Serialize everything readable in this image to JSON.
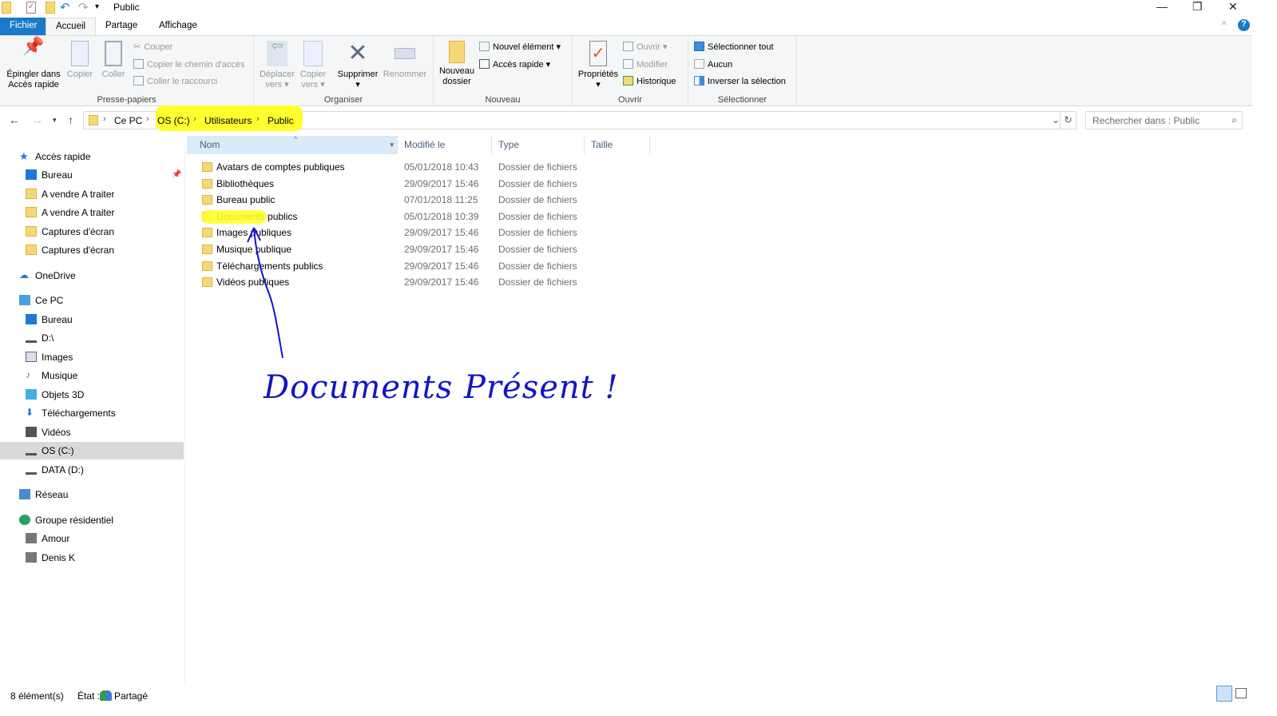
{
  "window": {
    "title": "Public",
    "minimize": "—",
    "restore": "❐",
    "close": "✕"
  },
  "tabs": [
    {
      "label": "Fichier"
    },
    {
      "label": "Accueil"
    },
    {
      "label": "Partage"
    },
    {
      "label": "Affichage"
    }
  ],
  "ribbon": {
    "presse_papiers": {
      "label": "Presse-papiers",
      "pin": "Épingler dans Accès rapide",
      "copy": "Copier",
      "paste": "Coller",
      "cut": "Couper",
      "copy_path": "Copier le chemin d'accès",
      "paste_shortcut": "Coller le raccourci"
    },
    "organiser": {
      "label": "Organiser",
      "move": "Déplacer vers",
      "copy_to": "Copier vers",
      "delete": "Supprimer",
      "rename": "Renommer"
    },
    "nouveau": {
      "label": "Nouveau",
      "new_folder": "Nouveau dossier",
      "new_item": "Nouvel élément ▾",
      "quick_access": "Accès rapide ▾"
    },
    "ouvrir": {
      "label": "Ouvrir",
      "properties": "Propriétés",
      "open": "Ouvrir ▾",
      "edit": "Modifier",
      "history": "Historique"
    },
    "selectionner": {
      "label": "Sélectionner",
      "all": "Sélectionner tout",
      "none": "Aucun",
      "invert": "Inverser la sélection"
    }
  },
  "address": {
    "crumbs": [
      "Ce PC",
      "OS (C:)",
      "Utilisateurs",
      "Public"
    ],
    "search_placeholder": "Rechercher dans : Public"
  },
  "columns": [
    "Nom",
    "Modifié le",
    "Type",
    "Taille"
  ],
  "files": [
    {
      "name": "Avatars de comptes publiques",
      "date": "05/01/2018 10:43",
      "type": "Dossier de fichiers"
    },
    {
      "name": "Bibliothèques",
      "date": "29/09/2017 15:46",
      "type": "Dossier de fichiers"
    },
    {
      "name": "Bureau public",
      "date": "07/01/2018 11:25",
      "type": "Dossier de fichiers"
    },
    {
      "name": "Documents publics",
      "date": "05/01/2018 10:39",
      "type": "Dossier de fichiers"
    },
    {
      "name": "Images publiques",
      "date": "29/09/2017 15:46",
      "type": "Dossier de fichiers"
    },
    {
      "name": "Musique publique",
      "date": "29/09/2017 15:46",
      "type": "Dossier de fichiers"
    },
    {
      "name": "Téléchargements publics",
      "date": "29/09/2017 15:46",
      "type": "Dossier de fichiers"
    },
    {
      "name": "Vidéos publiques",
      "date": "29/09/2017 15:46",
      "type": "Dossier de fichiers"
    }
  ],
  "sidebar": [
    {
      "label": "Accès rapide",
      "icon": "star-icon",
      "top": "196"
    },
    {
      "label": "Bureau",
      "icon": "desktop-icon"
    },
    {
      "label": "A vendre A traiter",
      "icon": "folder-icon"
    },
    {
      "label": "A vendre A traiter",
      "icon": "folder-icon"
    },
    {
      "label": "Captures d'écran",
      "icon": "folder-icon"
    },
    {
      "label": "Captures d'écran",
      "icon": "folder-icon"
    },
    {
      "label": "OneDrive",
      "icon": "cloud-icon"
    },
    {
      "label": "Ce PC",
      "icon": "computer-icon"
    },
    {
      "label": "Bureau",
      "icon": "desktop-icon"
    },
    {
      "label": "D:\\",
      "icon": "drive-icon"
    },
    {
      "label": "Images",
      "icon": "pictures-icon"
    },
    {
      "label": "Musique",
      "icon": "music-icon"
    },
    {
      "label": "Objets 3D",
      "icon": "cube-icon"
    },
    {
      "label": "Téléchargements",
      "icon": "download-icon"
    },
    {
      "label": "Vidéos",
      "icon": "video-icon"
    },
    {
      "label": "OS (C:)",
      "icon": "drive-icon"
    },
    {
      "label": "DATA (D:)",
      "icon": "drive-icon"
    },
    {
      "label": "Réseau",
      "icon": "network-icon"
    },
    {
      "label": "Groupe résidentiel",
      "icon": "homegroup-icon"
    },
    {
      "label": "Amour",
      "icon": "user-icon"
    },
    {
      "label": "Denis K",
      "icon": "user-icon"
    }
  ],
  "status": {
    "count": "8 élément(s)",
    "state": "État :",
    "shared": "Partagé"
  },
  "annotation": {
    "text": "Documents Présent !",
    "color": "#1414c8",
    "highlight": "#ffff2e"
  }
}
